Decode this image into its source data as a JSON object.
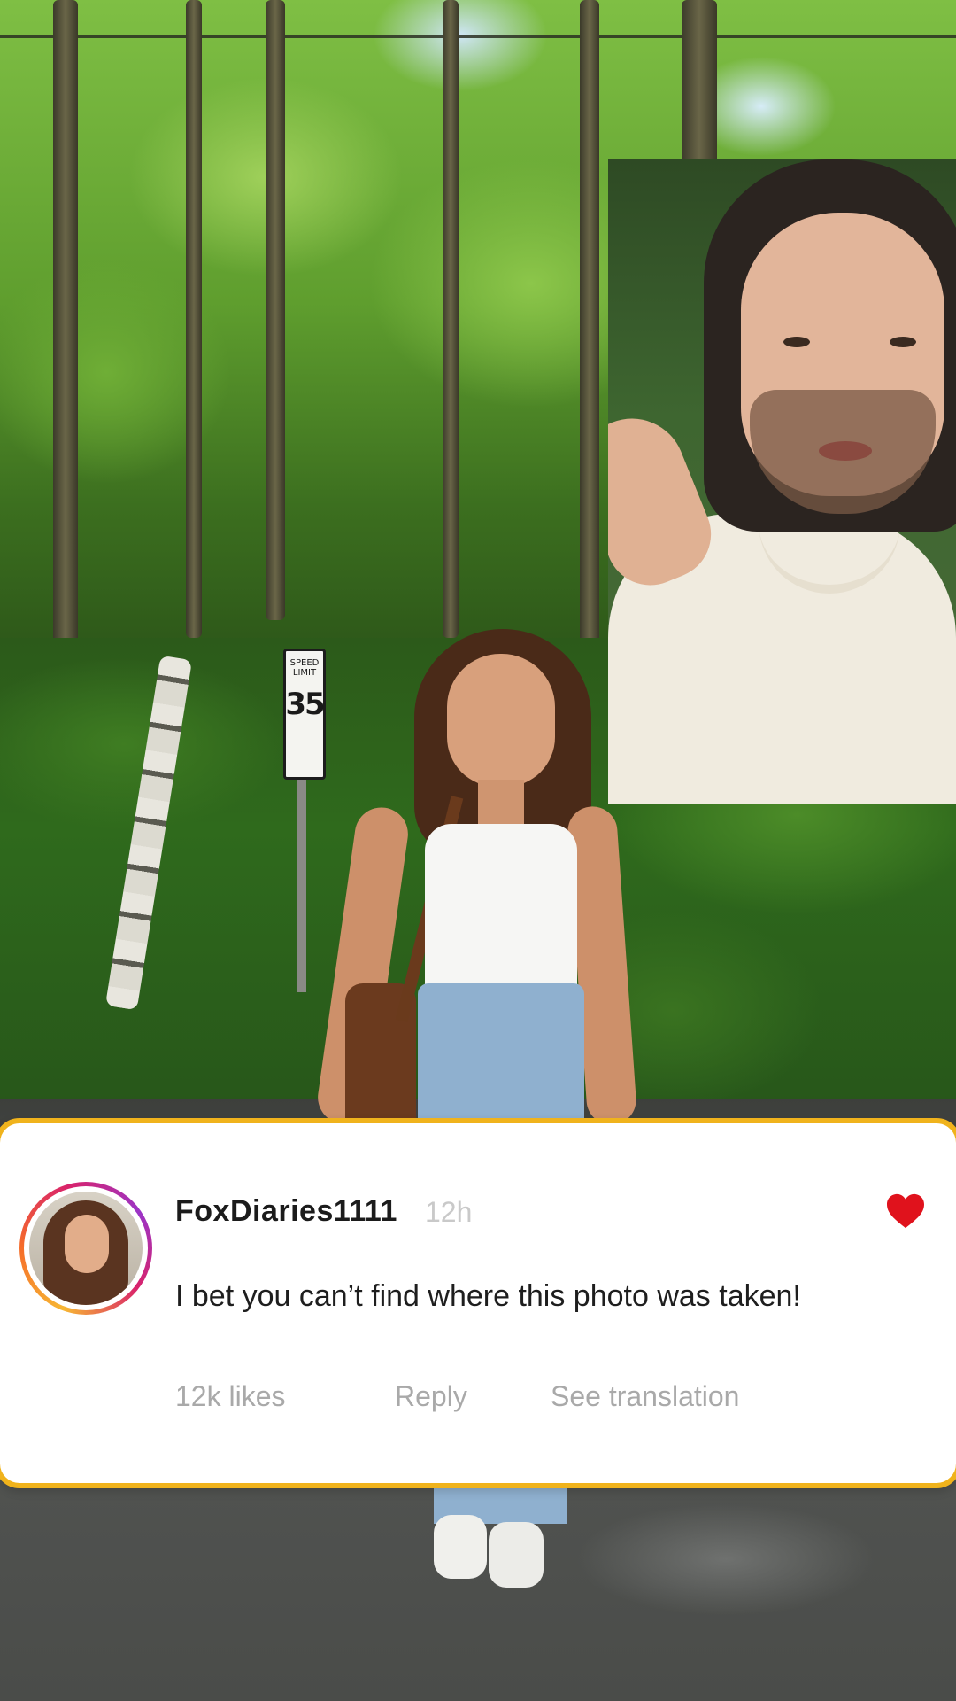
{
  "scene": {
    "sign": {
      "top_text": "SPEED LIMIT",
      "number": "35"
    }
  },
  "comment": {
    "username": "FoxDiaries1111",
    "time": "12h",
    "text": "I bet you can’t find where this photo was taken!",
    "likes": "12k likes",
    "reply_label": "Reply",
    "translate_label": "See translation",
    "liked": true,
    "colors": {
      "border": "#f0b31c",
      "heart": "#e0121c",
      "meta_text": "#a9a9a9"
    }
  },
  "icons": {
    "like": "heart-icon",
    "avatar": "profile-avatar"
  }
}
